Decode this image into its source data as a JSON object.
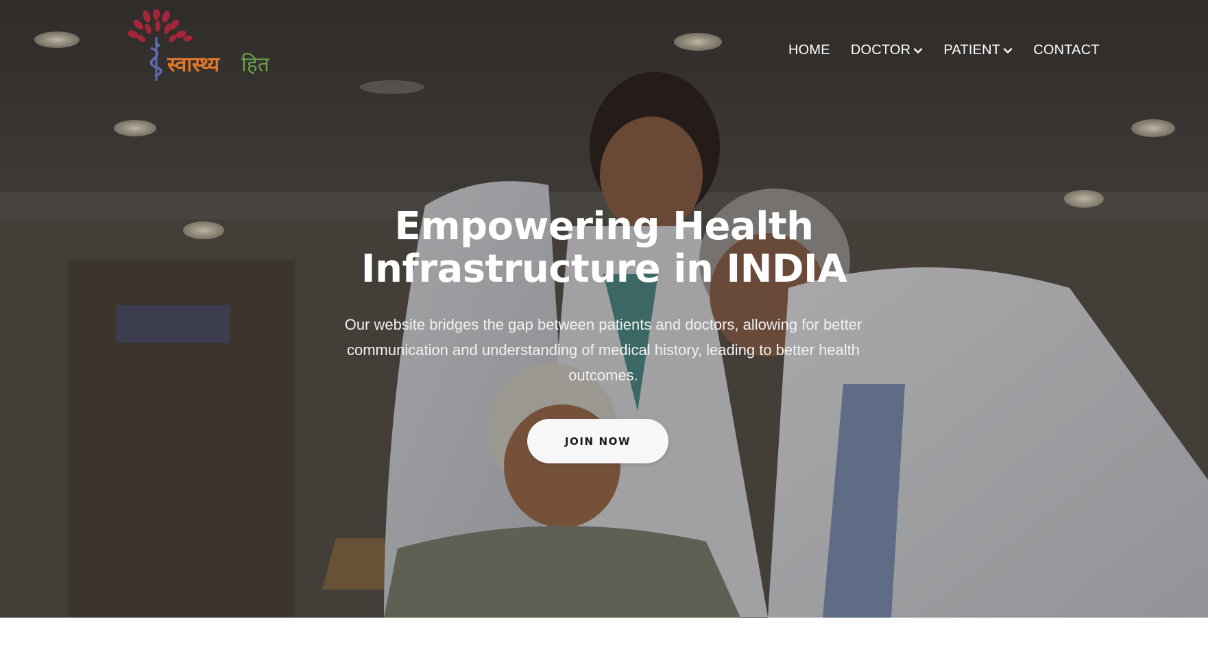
{
  "brand": {
    "logo_text_part1": "स्वास्थ्य",
    "logo_text_part2": "हित",
    "logo_colors": {
      "leaves": "#a3263a",
      "text1": "#e0782a",
      "text2": "#6aa04a",
      "caduceus": "#5b6db0"
    }
  },
  "nav": {
    "items": [
      {
        "label": "HOME",
        "has_dropdown": false
      },
      {
        "label": "DOCTOR",
        "has_dropdown": true
      },
      {
        "label": "PATIENT",
        "has_dropdown": true
      },
      {
        "label": "CONTACT",
        "has_dropdown": false
      }
    ]
  },
  "hero": {
    "title_line1": "Empowering Health",
    "title_line2": "Infrastructure in INDIA",
    "description": "Our website bridges the gap between patients and doctors, allowing for better communication and understanding of medical history, leading to better health outcomes.",
    "cta_label": "JOIN NOW"
  },
  "icons": {
    "dropdown": "chevron-down-icon"
  },
  "colors": {
    "nav_text": "#ffffff",
    "button_bg": "#f7f7f7",
    "button_text": "#1a1a1a"
  }
}
